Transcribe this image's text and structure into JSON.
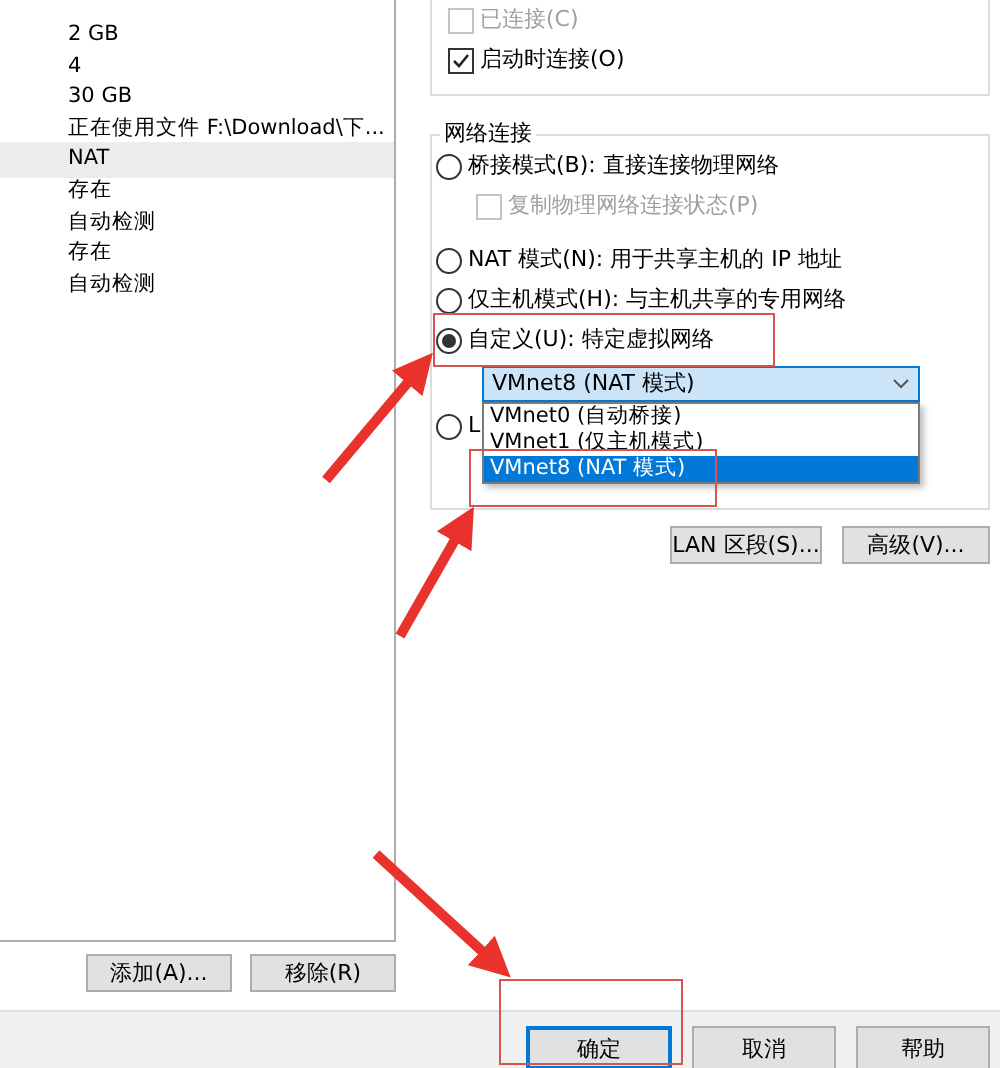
{
  "device_list": [
    {
      "text": "2 GB",
      "selected": false
    },
    {
      "text": "4",
      "selected": false
    },
    {
      "text": "30 GB",
      "selected": false
    },
    {
      "text": "正在使用文件 F:\\Download\\下...",
      "selected": false
    },
    {
      "text": "NAT",
      "selected": true
    },
    {
      "text": "存在",
      "selected": false
    },
    {
      "text": "自动检测",
      "selected": false
    },
    {
      "text": "存在",
      "selected": false
    },
    {
      "text": "自动检测",
      "selected": false
    }
  ],
  "list_buttons": [
    "添加(A)...",
    "移除(R)"
  ],
  "device_status": [
    {
      "label": "已连接(C)",
      "checked": false,
      "disabled": true
    },
    {
      "label": "启动时连接(O)",
      "checked": true,
      "disabled": false
    }
  ],
  "network_connection": {
    "title": "网络连接",
    "options": [
      {
        "kind": "radio",
        "label": "桥接模式(B): 直接连接物理网络",
        "selected": false
      },
      {
        "kind": "checkbox",
        "label": "复制物理网络连接状态(P)",
        "checked": false,
        "disabled": true
      },
      {
        "kind": "radio",
        "label": "NAT 模式(N): 用于共享主机的 IP 地址",
        "selected": false
      },
      {
        "kind": "radio",
        "label": "仅主机模式(H): 与主机共享的专用网络",
        "selected": false
      },
      {
        "kind": "radio",
        "label": "自定义(U): 特定虚拟网络",
        "selected": true
      },
      {
        "kind": "select",
        "value": "VMnet8 (NAT 模式)",
        "expanded": true
      },
      {
        "kind": "radio",
        "label": "L",
        "selected": false
      }
    ],
    "dropdown_list": [
      {
        "label": "VMnet0 (自动桥接)",
        "selected": false
      },
      {
        "label": "VMnet1 (仅主机模式)",
        "selected": false
      },
      {
        "label": "VMnet8 (NAT 模式)",
        "selected": true
      }
    ],
    "buttons": [
      "LAN 区段(S)...",
      "高级(V)..."
    ]
  },
  "dialog_buttons": [
    {
      "label": "确定",
      "focused": true
    },
    {
      "label": "取消",
      "focused": false
    },
    {
      "label": "帮助",
      "focused": false
    }
  ]
}
